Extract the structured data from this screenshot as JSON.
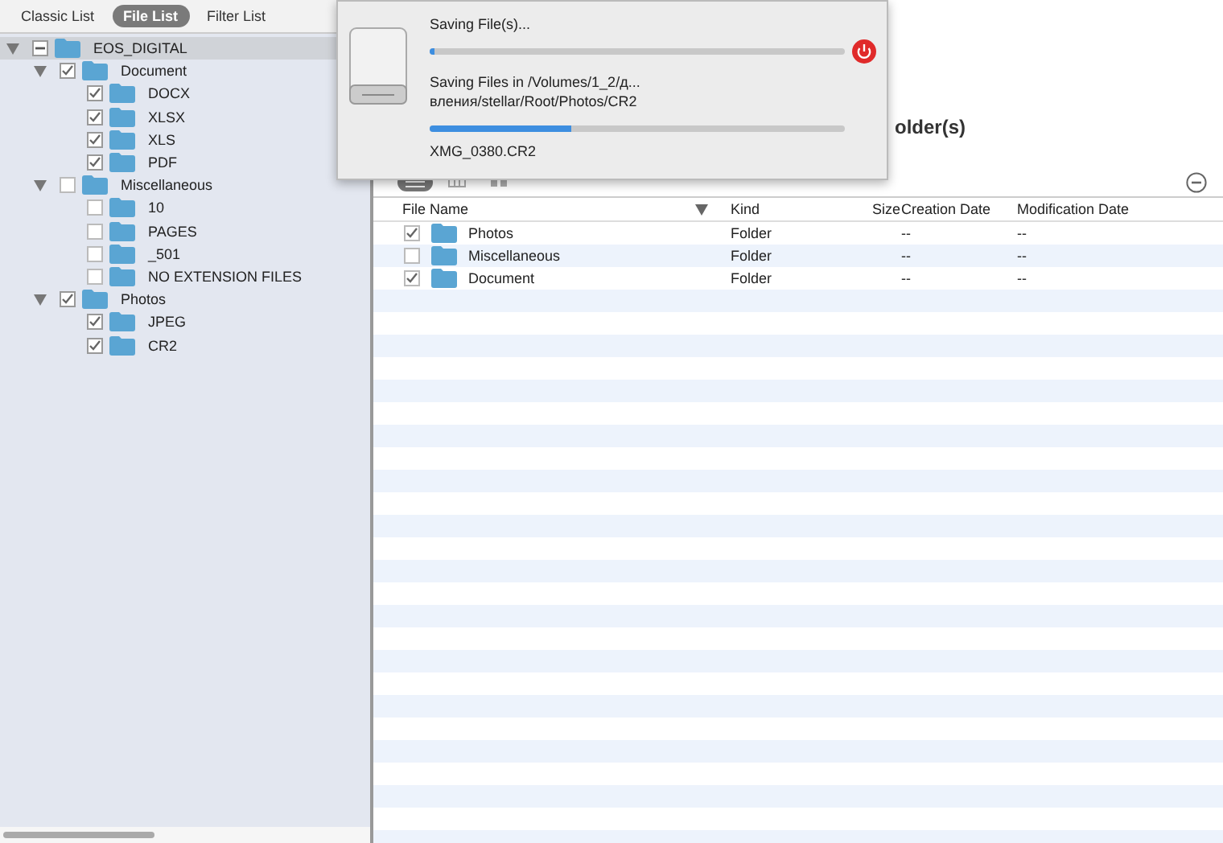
{
  "view_tabs": [
    {
      "label": "Classic List",
      "selected": false
    },
    {
      "label": "File List",
      "selected": true
    },
    {
      "label": "Filter List",
      "selected": false
    }
  ],
  "tree": [
    {
      "label": "EOS_DIGITAL",
      "checked": true,
      "partial": true,
      "selected": true,
      "expanded": true,
      "children": [
        {
          "label": "Document",
          "checked": true,
          "partial": false,
          "selected": false,
          "expanded": true,
          "children": [
            {
              "label": "DOCX",
              "checked": true,
              "partial": false,
              "selected": false
            },
            {
              "label": "XLSX",
              "checked": true,
              "partial": false,
              "selected": false
            },
            {
              "label": "XLS",
              "checked": true,
              "partial": false,
              "selected": false
            },
            {
              "label": "PDF",
              "checked": true,
              "partial": false,
              "selected": false
            }
          ]
        },
        {
          "label": "Miscellaneous",
          "checked": false,
          "partial": false,
          "selected": false,
          "expanded": true,
          "children": [
            {
              "label": "10",
              "checked": false,
              "partial": false,
              "selected": false
            },
            {
              "label": "PAGES",
              "checked": false,
              "partial": false,
              "selected": false
            },
            {
              "label": "_501",
              "checked": false,
              "partial": false,
              "selected": false
            },
            {
              "label": "NO EXTENSION FILES",
              "checked": false,
              "partial": false,
              "selected": false
            }
          ]
        },
        {
          "label": "Photos",
          "checked": true,
          "partial": false,
          "selected": false,
          "expanded": true,
          "children": [
            {
              "label": "JPEG",
              "checked": true,
              "partial": false,
              "selected": false
            },
            {
              "label": "CR2",
              "checked": true,
              "partial": false,
              "selected": false
            }
          ]
        }
      ]
    }
  ],
  "summary_fragment": "older(s)",
  "table": {
    "columns": [
      "File Name",
      "Kind",
      "Size",
      "Creation Date",
      "Modification Date"
    ],
    "rows": [
      {
        "name": "Photos",
        "checked": true,
        "kind": "Folder",
        "creation_date": "--",
        "modification_date": "--"
      },
      {
        "name": "Miscellaneous",
        "checked": false,
        "kind": "Folder",
        "creation_date": "--",
        "modification_date": "--"
      },
      {
        "name": "Document",
        "checked": true,
        "kind": "Folder",
        "creation_date": "--",
        "modification_date": "--"
      }
    ]
  },
  "dialog": {
    "title": "Saving File(s)...",
    "level": 0.01,
    "path": "Saving Files in /Volumes/1_2/д...\nвления/stellar/Root/Photos/CR2",
    "file_progress": {
      "level": 0.34
    },
    "file": "XMG_0380.CR2"
  }
}
